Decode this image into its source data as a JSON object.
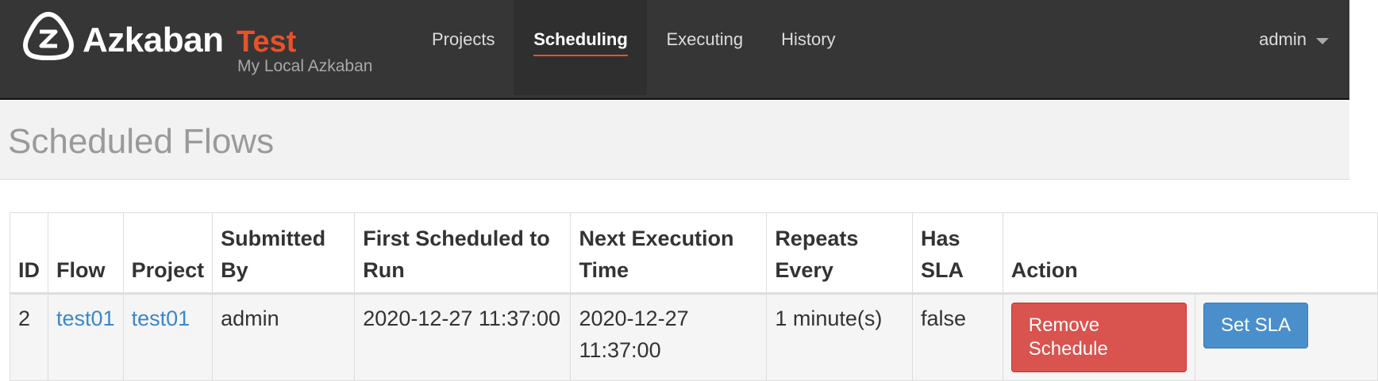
{
  "brand": {
    "name": "Azkaban",
    "env": "Test",
    "subtitle": "My Local Azkaban"
  },
  "nav": {
    "items": [
      {
        "label": "Projects",
        "active": false
      },
      {
        "label": "Scheduling",
        "active": true
      },
      {
        "label": "Executing",
        "active": false
      },
      {
        "label": "History",
        "active": false
      }
    ],
    "user": "admin"
  },
  "page": {
    "title": "Scheduled Flows"
  },
  "table": {
    "headers": [
      "ID",
      "Flow",
      "Project",
      "Submitted By",
      "First Scheduled to Run",
      "Next Execution Time",
      "Repeats Every",
      "Has SLA",
      "Action"
    ],
    "rows": [
      {
        "id": "2",
        "flow": "test01",
        "project": "test01",
        "submitted_by": "admin",
        "first_scheduled": "2020-12-27 11:37:00",
        "next_execution": "2020-12-27 11:37:00",
        "repeats": "1 minute(s)",
        "has_sla": "false",
        "remove_label": "Remove Schedule",
        "sla_label": "Set SLA"
      }
    ]
  },
  "colors": {
    "navbar": "#363636",
    "accent": "#e8512a",
    "link": "#3c87c7",
    "danger": "#d9534f",
    "info": "#4a8fcb"
  }
}
